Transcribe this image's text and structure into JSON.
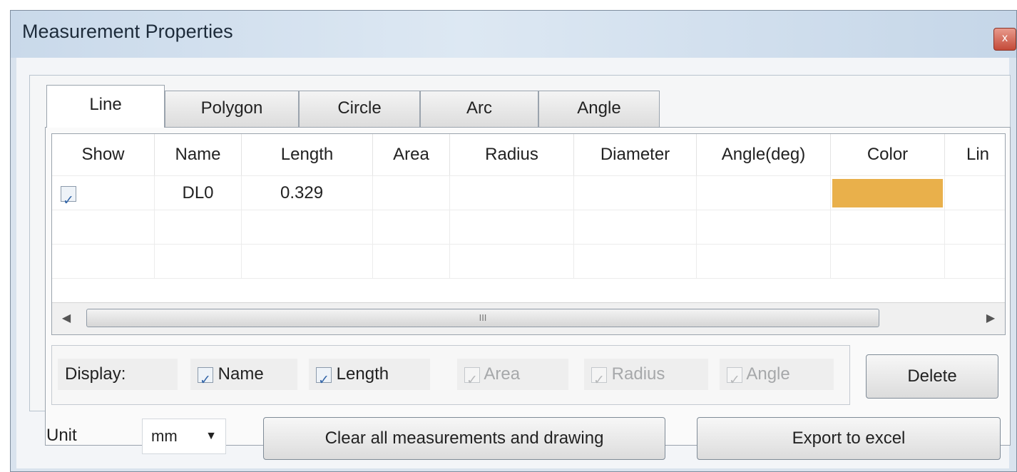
{
  "window": {
    "title": "Measurement Properties",
    "close_glyph": "x"
  },
  "tabs": [
    {
      "label": "Line",
      "active": true
    },
    {
      "label": "Polygon",
      "active": false
    },
    {
      "label": "Circle",
      "active": false
    },
    {
      "label": "Arc",
      "active": false
    },
    {
      "label": "Angle",
      "active": false
    }
  ],
  "grid": {
    "columns": [
      "Show",
      "Name",
      "Length",
      "Area",
      "Radius",
      "Diameter",
      "Angle(deg)",
      "Color",
      "Lin"
    ],
    "rows": [
      {
        "show": true,
        "name": "DL0",
        "length": "0.329",
        "area": "",
        "radius": "",
        "diameter": "",
        "angle": "",
        "color": "#e9b04b"
      }
    ],
    "scroll_thumb_glyph": "III"
  },
  "display": {
    "label": "Display:",
    "options": [
      {
        "label": "Name",
        "checked": true,
        "enabled": true
      },
      {
        "label": "Length",
        "checked": true,
        "enabled": true
      },
      {
        "label": "Area",
        "checked": true,
        "enabled": false
      },
      {
        "label": "Radius",
        "checked": true,
        "enabled": false
      },
      {
        "label": "Angle",
        "checked": true,
        "enabled": false
      }
    ]
  },
  "buttons": {
    "delete": "Delete",
    "clear_all": "Clear all measurements and drawing",
    "export": "Export to excel"
  },
  "unit": {
    "label": "Unit",
    "value": "mm"
  }
}
